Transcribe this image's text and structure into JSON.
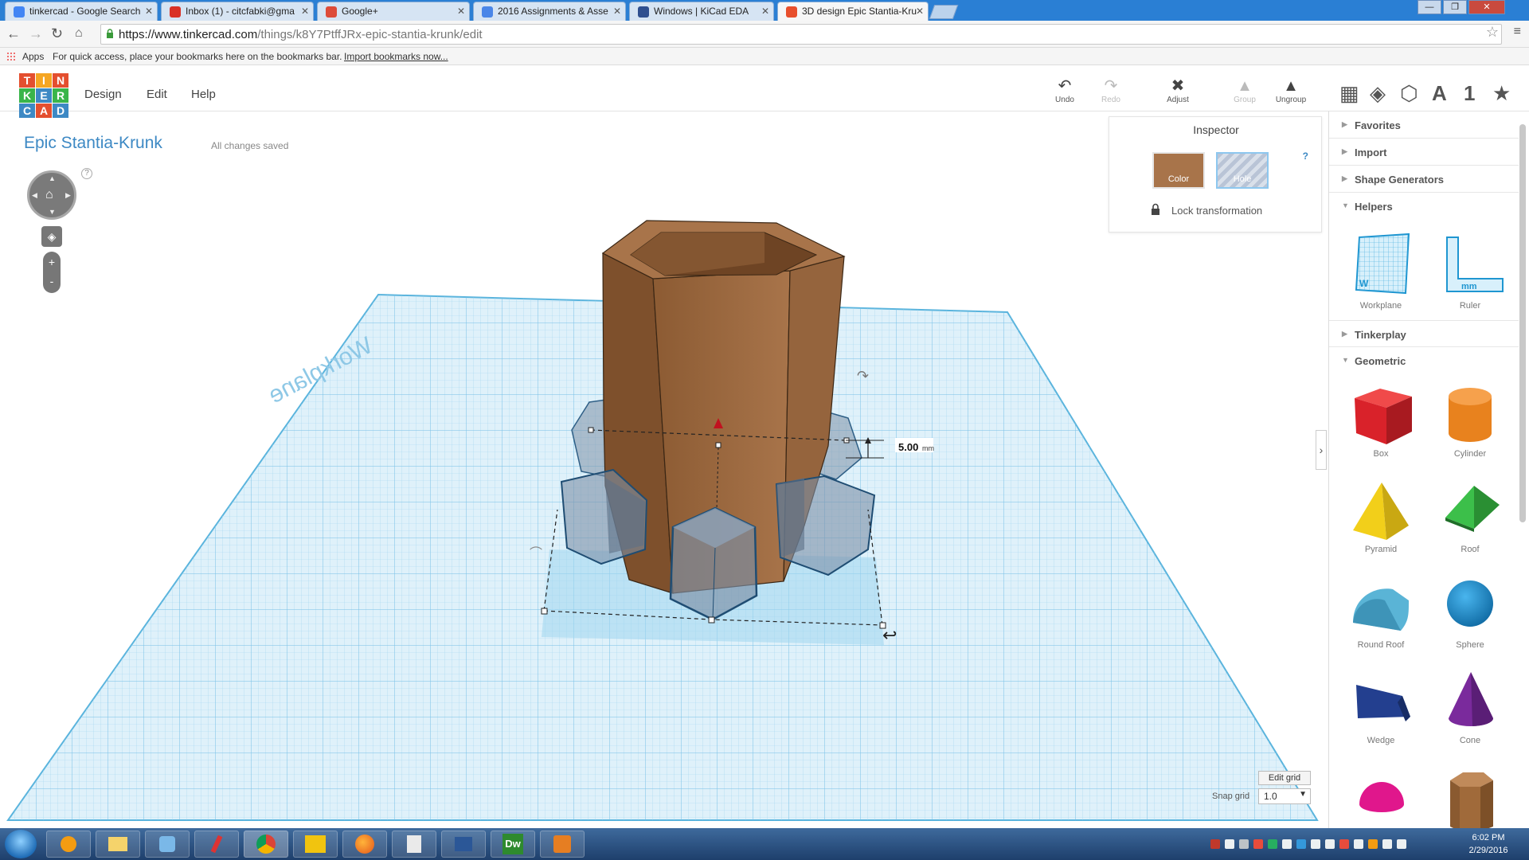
{
  "browser": {
    "tabs": [
      {
        "title": "tinkercad - Google Search",
        "favicon_color": "#4285f4"
      },
      {
        "title": "Inbox (1) - citcfabki@gma",
        "favicon_color": "#d93025"
      },
      {
        "title": "Google+",
        "favicon_color": "#dd4b39"
      },
      {
        "title": "2016 Assignments & Asse",
        "favicon_color": "#4a86e8"
      },
      {
        "title": "Windows | KiCad EDA",
        "favicon_color": "#2f4f8f"
      },
      {
        "title": "3D design Epic Stantia-Kru",
        "favicon_color": "#e84f2c"
      }
    ],
    "url_host": "https://www.tinkercad.com",
    "url_path": "/things/k8Y7PtffJRx-epic-stantia-krunk/edit",
    "bookmarks": {
      "apps_label": "Apps",
      "hint": "For quick access, place your bookmarks here on the bookmarks bar.",
      "import_link": "Import bookmarks now..."
    }
  },
  "app": {
    "logo_letters": [
      "T",
      "I",
      "N",
      "K",
      "E",
      "R",
      "C",
      "A",
      "D"
    ],
    "logo_colors": [
      "#e44f2f",
      "#f5a623",
      "#e44f2f",
      "#3ab54a",
      "#3d89c4",
      "#3ab54a",
      "#3d89c4",
      "#e44f2f",
      "#3d89c4"
    ],
    "menu": [
      "Design",
      "Edit",
      "Help"
    ],
    "toolbar": [
      {
        "label": "Undo",
        "icon": "undo-icon",
        "glyph": "↶",
        "enabled": true
      },
      {
        "label": "Redo",
        "icon": "redo-icon",
        "glyph": "↷",
        "enabled": false
      },
      {
        "label": "Adjust",
        "icon": "adjust-icon",
        "glyph": "✖",
        "enabled": true
      },
      {
        "label": "Group",
        "icon": "group-icon",
        "glyph": "▲",
        "enabled": false
      },
      {
        "label": "Ungroup",
        "icon": "ungroup-icon",
        "glyph": "▲",
        "enabled": true
      }
    ],
    "view_icons": [
      {
        "icon": "workplane-view-icon",
        "glyph": "▦"
      },
      {
        "icon": "box-view-icon",
        "glyph": "◈"
      },
      {
        "icon": "wireframe-view-icon",
        "glyph": "⬡"
      },
      {
        "icon": "text-tool-icon",
        "glyph": "A"
      },
      {
        "icon": "number-tool-icon",
        "glyph": "1"
      },
      {
        "icon": "favorites-star-icon",
        "glyph": "★"
      }
    ],
    "design_title": "Epic Stantia-Krunk",
    "save_status": "All changes saved",
    "nav_help": "?",
    "zoom_in": "+",
    "zoom_out": "-"
  },
  "inspector": {
    "title": "Inspector",
    "help": "?",
    "color_label": "Color",
    "hole_label": "Hole",
    "lock_label": "Lock transformation",
    "color_value": "#a8744a"
  },
  "scene": {
    "workplane_label": "Workplane",
    "dimension_value": "5.00",
    "dimension_unit": "mm",
    "grid_color": "#9dd3ef"
  },
  "grid_controls": {
    "edit_grid": "Edit grid",
    "snap_label": "Snap grid",
    "snap_value": "1.0"
  },
  "shapes_panel": {
    "sections": {
      "favorites": "Favorites",
      "import": "Import",
      "shape_generators": "Shape Generators",
      "helpers": "Helpers",
      "tinkerplay": "Tinkerplay",
      "geometric": "Geometric"
    },
    "helpers": [
      "Workplane",
      "Ruler"
    ],
    "geometric": [
      {
        "name": "Box",
        "color": "#d9222a"
      },
      {
        "name": "Cylinder",
        "color": "#e8821e"
      },
      {
        "name": "Pyramid",
        "color": "#f2cf1a"
      },
      {
        "name": "Roof",
        "color": "#2ea33a"
      },
      {
        "name": "Round Roof",
        "color": "#5ab4d6"
      },
      {
        "name": "Sphere",
        "color": "#1a8fd0"
      },
      {
        "name": "Wedge",
        "color": "#233f8f"
      },
      {
        "name": "Cone",
        "color": "#7a2a9c"
      },
      {
        "name": "Half Sphere",
        "color": "#e0178c"
      },
      {
        "name": "Hexagonal Prism",
        "color": "#a06a3a"
      }
    ]
  },
  "taskbar": {
    "apps": [
      "",
      "",
      "",
      "",
      "",
      "",
      "",
      "",
      "",
      "",
      "Dw",
      ""
    ],
    "time": "6:02 PM",
    "date": "2/29/2016"
  }
}
